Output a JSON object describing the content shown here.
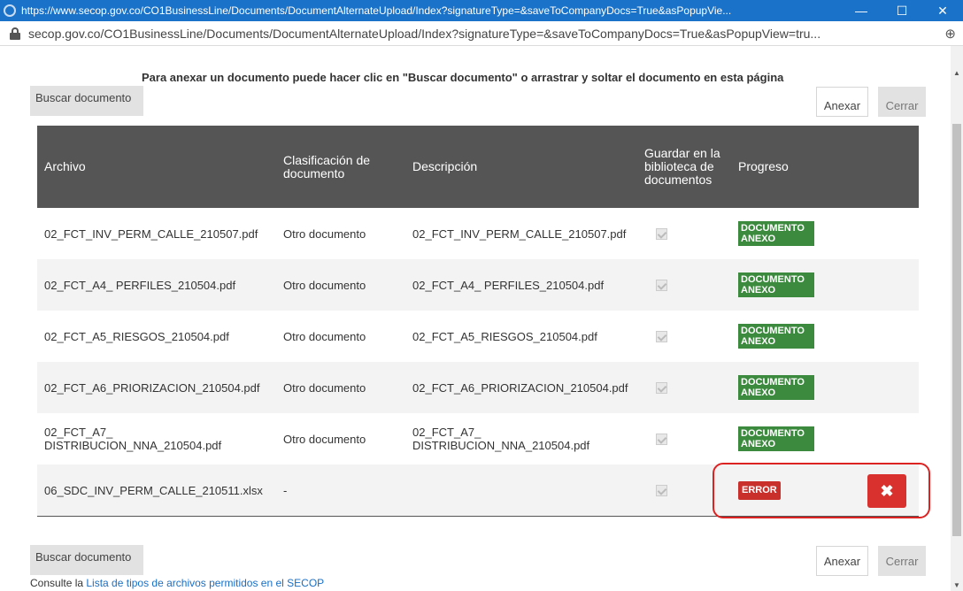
{
  "window": {
    "title": "https://www.secop.gov.co/CO1BusinessLine/Documents/DocumentAlternateUpload/Index?signatureType=&saveToCompanyDocs=True&asPopupVie...",
    "minimize_glyph": "—",
    "maximize_glyph": "☐",
    "close_glyph": "✕"
  },
  "address_bar": {
    "url": "secop.gov.co/CO1BusinessLine/Documents/DocumentAlternateUpload/Index?signatureType=&saveToCompanyDocs=True&asPopupView=tru...",
    "zoom_glyph": "⊕"
  },
  "page": {
    "instruction": "Para anexar un documento puede hacer clic en \"Buscar documento\" o arrastrar y soltar el documento en esta página",
    "buttons": {
      "search": "Buscar documento",
      "attach": "Anexar",
      "close": "Cerrar"
    },
    "table": {
      "headers": {
        "file": "Archivo",
        "classification": "Clasificación de documento",
        "description": "Descripción",
        "save_library": "Guardar en la biblioteca de documentos",
        "progress": "Progreso"
      },
      "rows": [
        {
          "file": "02_FCT_INV_PERM_CALLE_210507.pdf",
          "classification": "Otro documento",
          "description": "02_FCT_INV_PERM_CALLE_210507.pdf",
          "status": "DOCUMENTO ANEXO"
        },
        {
          "file": "02_FCT_A4_ PERFILES_210504.pdf",
          "classification": "Otro documento",
          "description": "02_FCT_A4_ PERFILES_210504.pdf",
          "status": "DOCUMENTO ANEXO"
        },
        {
          "file": "02_FCT_A5_RIESGOS_210504.pdf",
          "classification": "Otro documento",
          "description": "02_FCT_A5_RIESGOS_210504.pdf",
          "status": "DOCUMENTO ANEXO"
        },
        {
          "file": "02_FCT_A6_PRIORIZACION_210504.pdf",
          "classification": "Otro documento",
          "description": "02_FCT_A6_PRIORIZACION_210504.pdf",
          "status": "DOCUMENTO ANEXO"
        },
        {
          "file": "02_FCT_A7_ DISTRIBUCION_NNA_210504.pdf",
          "classification": "Otro documento",
          "description": "02_FCT_A7_ DISTRIBUCION_NNA_210504.pdf",
          "status": "DOCUMENTO ANEXO"
        },
        {
          "file": "06_SDC_INV_PERM_CALLE_210511.xlsx",
          "classification": "-",
          "description": "",
          "status": "ERROR"
        }
      ],
      "delete_glyph": "✖"
    },
    "footer": {
      "prefix": "Consulte la ",
      "link": "Lista de tipos de archivos permitidos en el SECOP"
    }
  },
  "colors": {
    "titlebar": "#1a73c8",
    "header_bg": "#555555",
    "success": "#3b8a3e",
    "error": "#c9302c",
    "link": "#1a6fc4"
  }
}
